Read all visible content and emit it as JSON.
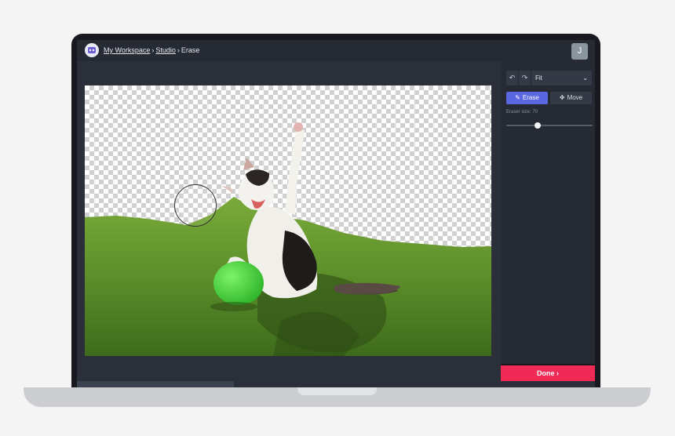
{
  "breadcrumb": {
    "workspace": "My Workspace",
    "separator": "›",
    "studio": "Studio",
    "current": "Erase"
  },
  "user": {
    "initial": "J"
  },
  "toolbar": {
    "undo_icon": "↶",
    "redo_icon": "↷",
    "zoom_value": "Fit",
    "zoom_chevron": "⌄"
  },
  "tools": {
    "erase_icon": "✎",
    "erase_label": "Erase",
    "move_icon": "✥",
    "move_label": "Move"
  },
  "eraser": {
    "label": "Eraser size: 70",
    "size": 70
  },
  "done": {
    "label": "Done",
    "icon": "›"
  },
  "colors": {
    "accent": "#5a67e0",
    "done": "#ee2a55",
    "panel": "#262a33",
    "workspace": "#2b2f39"
  }
}
